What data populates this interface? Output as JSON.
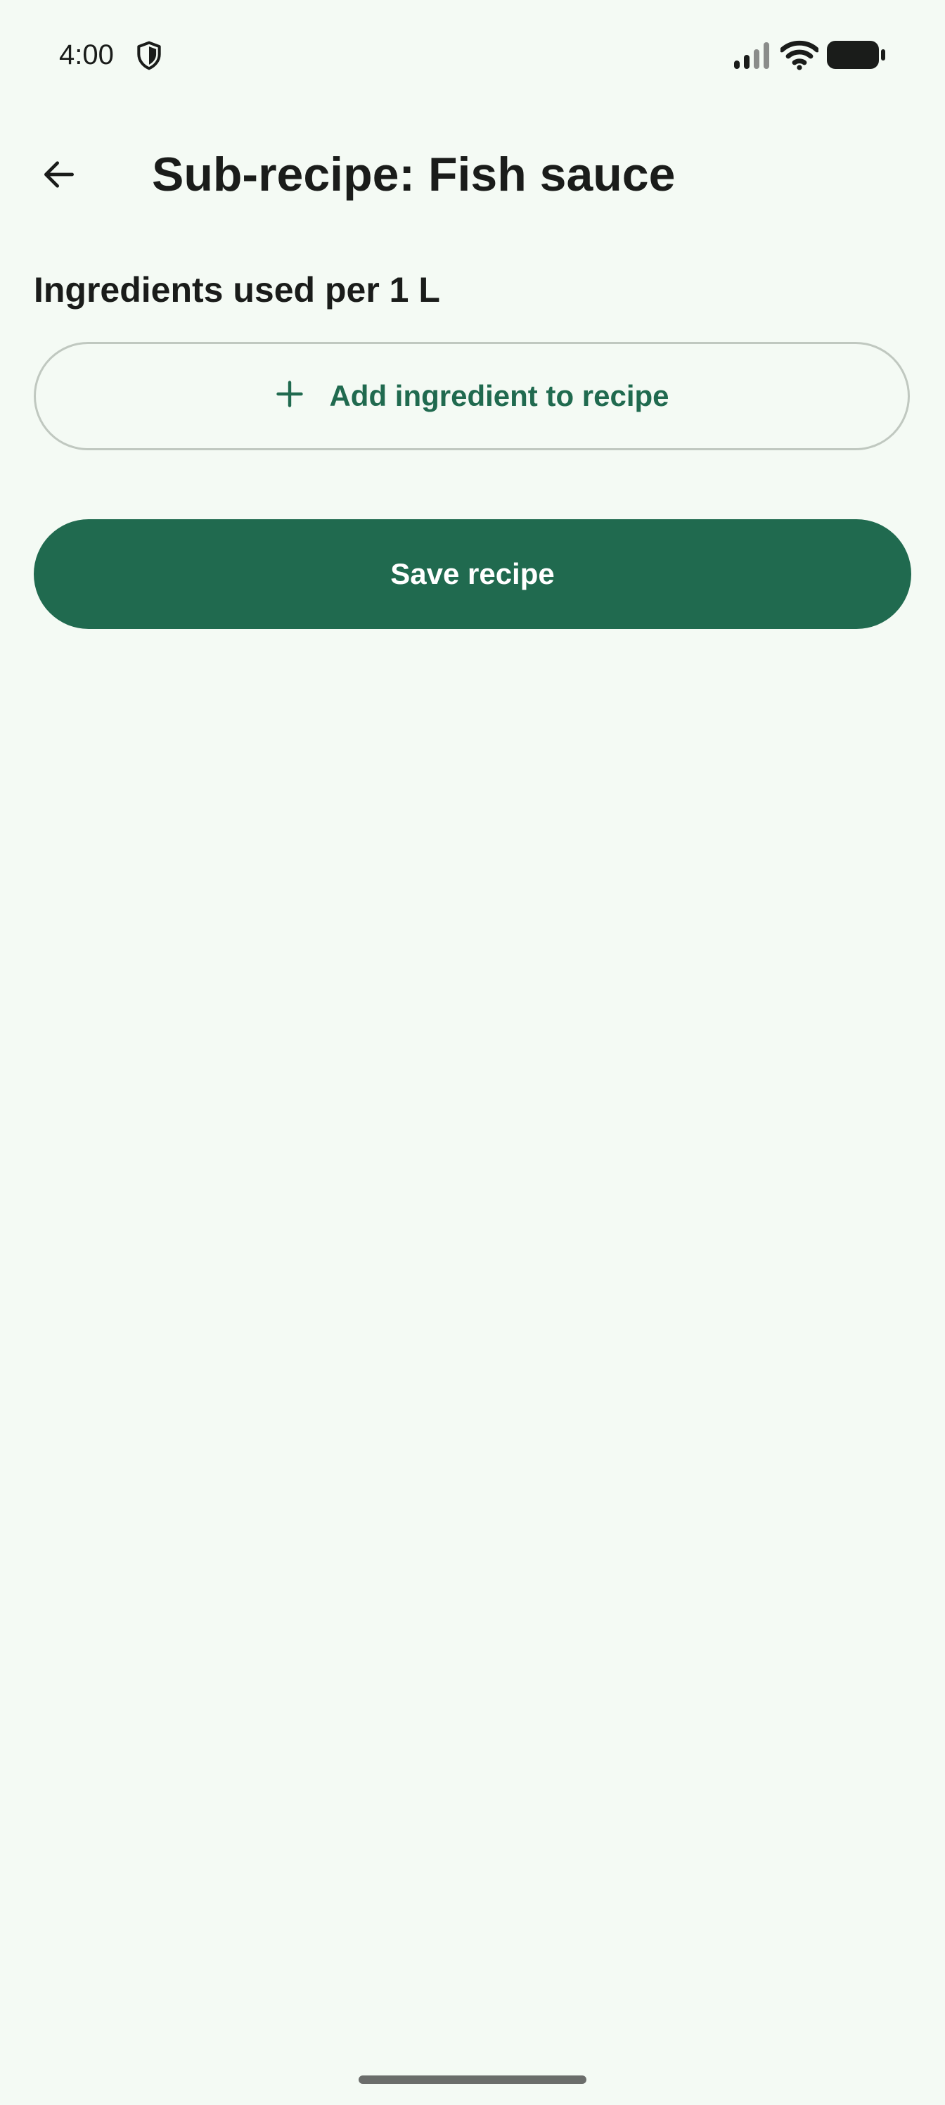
{
  "status_bar": {
    "time": "4:00",
    "icons": [
      "shield-icon",
      "cell-signal-icon",
      "wifi-icon",
      "battery-icon"
    ]
  },
  "app_bar": {
    "back_icon": "arrow-back-icon",
    "title": "Sub-recipe: Fish sauce"
  },
  "content": {
    "section_label": "Ingredients used per 1 L",
    "add_button_icon": "plus-icon",
    "add_button_label": "Add ingredient to recipe",
    "save_button_label": "Save recipe"
  },
  "colors": {
    "background": "#f4faf4",
    "accent": "#206a4f",
    "outline": "#c0c8c0",
    "on_accent": "#ffffff",
    "text": "#1a1c1a"
  }
}
